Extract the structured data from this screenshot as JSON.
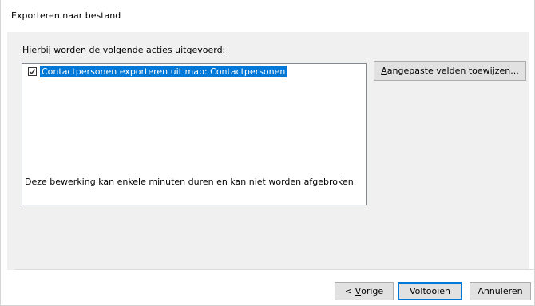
{
  "window": {
    "title": "Exporteren naar bestand"
  },
  "dialog": {
    "instructions": "Hierbij worden de volgende acties uitgevoerd:",
    "actions": [
      {
        "label": "Contactpersonen exporteren uit map: Contactpersonen",
        "checked": true,
        "selected": true
      }
    ],
    "info_text": "Deze bewerking kan enkele minuten duren en kan niet worden afgebroken."
  },
  "buttons": {
    "map_fields": {
      "mnemonic": "A",
      "rest": "angepaste velden toewijzen..."
    },
    "back": {
      "prefix": "< ",
      "mnemonic": "V",
      "rest": "orige"
    },
    "finish": {
      "label": "Voltooien"
    },
    "cancel": {
      "label": "Annuleren"
    }
  },
  "colors": {
    "selection": "#0078d7",
    "dialog_background": "#f0f0f0",
    "button_face": "#e1e1e1",
    "default_button_border": "#0078d7"
  },
  "icons": {
    "checkbox": "checkmark-icon"
  }
}
